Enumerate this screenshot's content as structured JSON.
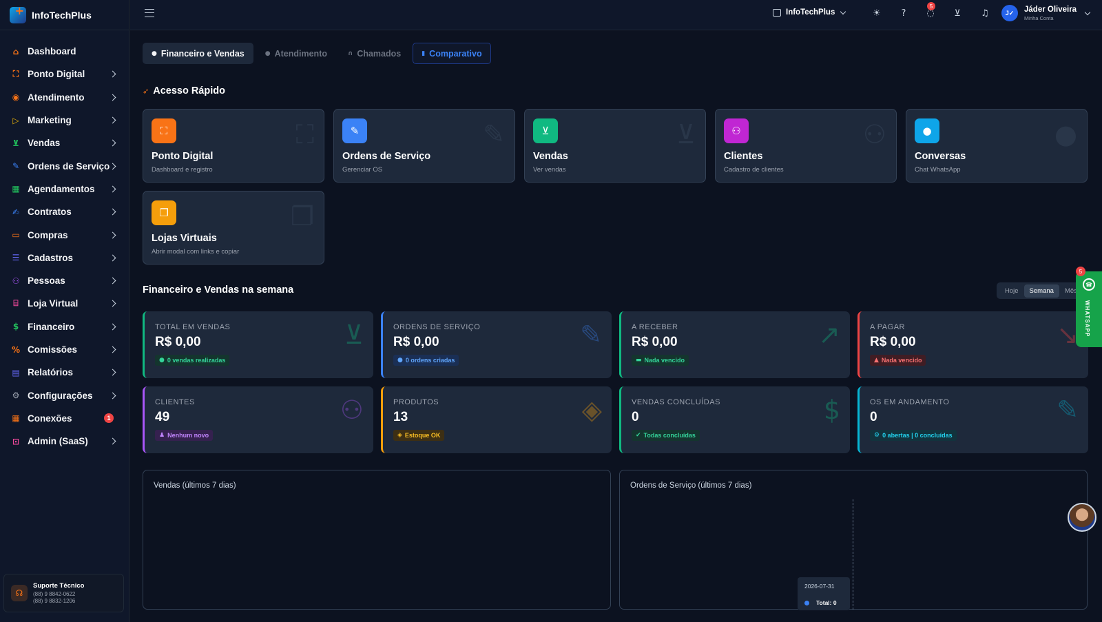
{
  "brand": {
    "name": "InfoTechPlus"
  },
  "sidebar": {
    "items": [
      {
        "label": "Dashboard",
        "icon": "home-icon",
        "color": "#f97316",
        "chevron": false
      },
      {
        "label": "Ponto Digital",
        "icon": "scan-icon",
        "color": "#f97316",
        "chevron": true
      },
      {
        "label": "Atendimento",
        "icon": "chat-icon",
        "color": "#f97316",
        "chevron": true
      },
      {
        "label": "Marketing",
        "icon": "megaphone-icon",
        "color": "#eab308",
        "chevron": true
      },
      {
        "label": "Vendas",
        "icon": "cart-icon",
        "color": "#22c55e",
        "chevron": true
      },
      {
        "label": "Ordens de Serviço",
        "icon": "wrench-icon",
        "color": "#3b82f6",
        "chevron": true
      },
      {
        "label": "Agendamentos",
        "icon": "calendar-icon",
        "color": "#22c55e",
        "chevron": true
      },
      {
        "label": "Contratos",
        "icon": "signature-icon",
        "color": "#3b82f6",
        "chevron": true
      },
      {
        "label": "Compras",
        "icon": "bag-icon",
        "color": "#f97316",
        "chevron": true
      },
      {
        "label": "Cadastros",
        "icon": "database-icon",
        "color": "#6366f1",
        "chevron": true
      },
      {
        "label": "Pessoas",
        "icon": "people-icon",
        "color": "#a855f7",
        "chevron": true
      },
      {
        "label": "Loja Virtual",
        "icon": "store-icon",
        "color": "#ec4899",
        "chevron": true
      },
      {
        "label": "Financeiro",
        "icon": "dollar-icon",
        "color": "#22c55e",
        "chevron": true
      },
      {
        "label": "Comissões",
        "icon": "percent-icon",
        "color": "#f97316",
        "chevron": true
      },
      {
        "label": "Relatórios",
        "icon": "document-icon",
        "color": "#6366f1",
        "chevron": true
      },
      {
        "label": "Configurações",
        "icon": "gear-icon",
        "color": "#9ca3af",
        "chevron": true
      },
      {
        "label": "Conexões",
        "icon": "grid-icon",
        "color": "#f97316",
        "chevron": false,
        "badge": "1"
      },
      {
        "label": "Admin (SaaS)",
        "icon": "lock-icon",
        "color": "#ec4899",
        "chevron": true
      }
    ],
    "support": {
      "title": "Suporte Técnico",
      "phone1": "(88) 9 8842-0622",
      "phone2": "(88) 9 8832-1206"
    }
  },
  "topbar": {
    "company": "InfoTechPlus",
    "whatsapp_badge": "5",
    "user_name": "Jáder Oliveira",
    "user_sub": "Minha Conta",
    "user_initials": "J✓"
  },
  "tabs": [
    {
      "label": "Financeiro e Vendas",
      "icon": "info-icon"
    },
    {
      "label": "Atendimento",
      "icon": "chat-icon"
    },
    {
      "label": "Chamados",
      "icon": "headset-icon"
    },
    {
      "label": "Comparativo",
      "icon": "bar-chart-icon"
    }
  ],
  "quick_access": {
    "title": "Acesso Rápido",
    "cards": [
      {
        "title": "Ponto Digital",
        "sub": "Dashboard e registro",
        "icon": "scan-icon",
        "color": "#f97316"
      },
      {
        "title": "Ordens de Serviço",
        "sub": "Gerenciar OS",
        "icon": "wrench-icon",
        "color": "#3b82f6"
      },
      {
        "title": "Vendas",
        "sub": "Ver vendas",
        "icon": "cart-icon",
        "color": "#10b981"
      },
      {
        "title": "Clientes",
        "sub": "Cadastro de clientes",
        "icon": "users-icon",
        "color": "#c026d3"
      },
      {
        "title": "Conversas",
        "sub": "Chat WhatsApp",
        "icon": "chat-icon",
        "color": "#0ea5e9"
      },
      {
        "title": "Lojas Virtuais",
        "sub": "Abrir modal com links e copiar",
        "icon": "copy-icon",
        "color": "#f59e0b"
      }
    ]
  },
  "week": {
    "title": "Financeiro e Vendas na semana",
    "period": {
      "today": "Hoje",
      "week": "Semana",
      "month": "Mês"
    }
  },
  "stats": [
    {
      "label": "TOTAL EM VENDAS",
      "value": "R$ 0,00",
      "chip": "0 vendas realizadas",
      "color": "#10b981"
    },
    {
      "label": "ORDENS DE SERVIÇO",
      "value": "R$ 0,00",
      "chip": "0 ordens criadas",
      "color": "#3b82f6"
    },
    {
      "label": "A RECEBER",
      "value": "R$ 0,00",
      "chip": "Nada vencido",
      "color": "#10b981"
    },
    {
      "label": "A PAGAR",
      "value": "R$ 0,00",
      "chip": "Nada vencido",
      "color": "#ef4444"
    },
    {
      "label": "CLIENTES",
      "value": "49",
      "chip": "Nenhum novo",
      "color": "#a855f7"
    },
    {
      "label": "PRODUTOS",
      "value": "13",
      "chip": "Estoque OK",
      "color": "#f59e0b"
    },
    {
      "label": "VENDAS CONCLUÍDAS",
      "value": "0",
      "chip": "Todas concluídas",
      "color": "#10b981"
    },
    {
      "label": "OS EM ANDAMENTO",
      "value": "0",
      "chip": "0 abertas | 0 concluídas",
      "color": "#06b6d4"
    }
  ],
  "charts": {
    "sales_title": "Vendas (últimos 7 dias)",
    "os_title": "Ordens de Serviço (últimos 7 dias)",
    "tooltip_date": "2026-07-31",
    "tooltip_label": "Total:",
    "tooltip_value": "0"
  },
  "whatsapp_widget": {
    "label": "WHATSAPP",
    "badge": "5"
  }
}
